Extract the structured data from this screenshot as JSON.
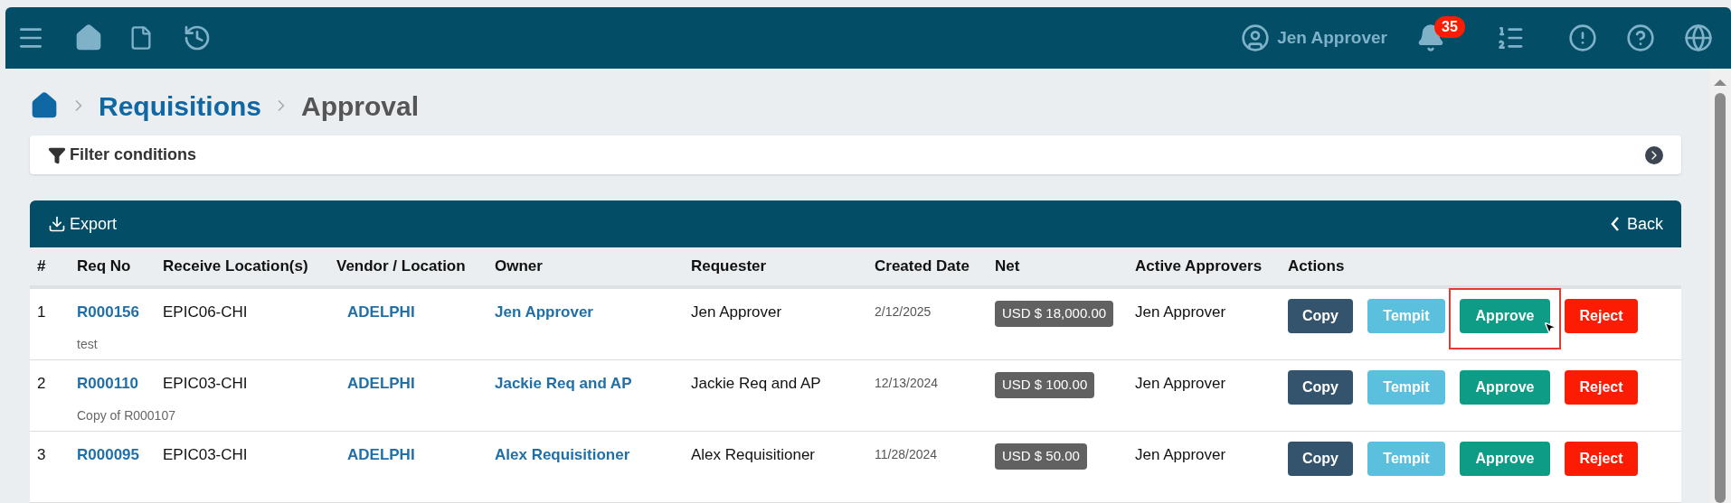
{
  "top_bar": {
    "user_name": "Jen Approver",
    "notification_count": "35"
  },
  "breadcrumb": {
    "parent": "Requisitions",
    "current": "Approval"
  },
  "filter": {
    "label": "Filter conditions"
  },
  "toolbar": {
    "export": "Export",
    "back": "Back"
  },
  "table": {
    "columns": [
      "#",
      "Req No",
      "Receive Location(s)",
      "Vendor / Location",
      "Owner",
      "Requester",
      "Created Date",
      "Net",
      "Active Approvers",
      "Actions"
    ],
    "rows": [
      {
        "index": "1",
        "req_no": "R000156",
        "note": "test",
        "location": "EPIC06-CHI",
        "vendor": "ADELPHI",
        "owner": "Jen Approver",
        "requester": "Jen Approver",
        "created": "2/12/2025",
        "net": "USD $ 18,000.00",
        "approvers": "Jen Approver",
        "actions": [
          {
            "label": "Copy",
            "kind": "copy",
            "highlighted": false
          },
          {
            "label": "Tempit",
            "kind": "tempit",
            "highlighted": false
          },
          {
            "label": "Approve",
            "kind": "approve",
            "highlighted": true
          },
          {
            "label": "Reject",
            "kind": "reject",
            "highlighted": false
          }
        ]
      },
      {
        "index": "2",
        "req_no": "R000110",
        "note": "Copy of R000107",
        "location": "EPIC03-CHI",
        "vendor": "ADELPHI",
        "owner": "Jackie Req and AP",
        "requester": "Jackie Req and AP",
        "created": "12/13/2024",
        "net": "USD $ 100.00",
        "approvers": "Jen Approver",
        "actions": [
          {
            "label": "Copy",
            "kind": "copy",
            "highlighted": false
          },
          {
            "label": "Tempit",
            "kind": "tempit",
            "highlighted": false
          },
          {
            "label": "Approve",
            "kind": "approve",
            "highlighted": false
          },
          {
            "label": "Reject",
            "kind": "reject",
            "highlighted": false
          }
        ]
      },
      {
        "index": "3",
        "req_no": "R000095",
        "location": "EPIC03-CHI",
        "vendor": "ADELPHI",
        "owner": "Alex Requisitioner",
        "requester": "Alex Requisitioner",
        "created": "11/28/2024",
        "net": "USD $ 50.00",
        "approvers": "Jen Approver",
        "actions": [
          {
            "label": "Copy",
            "kind": "copy",
            "highlighted": false
          },
          {
            "label": "Tempit",
            "kind": "tempit",
            "highlighted": false
          },
          {
            "label": "Approve",
            "kind": "approve",
            "highlighted": false
          },
          {
            "label": "Reject",
            "kind": "reject",
            "highlighted": false
          }
        ]
      }
    ]
  }
}
